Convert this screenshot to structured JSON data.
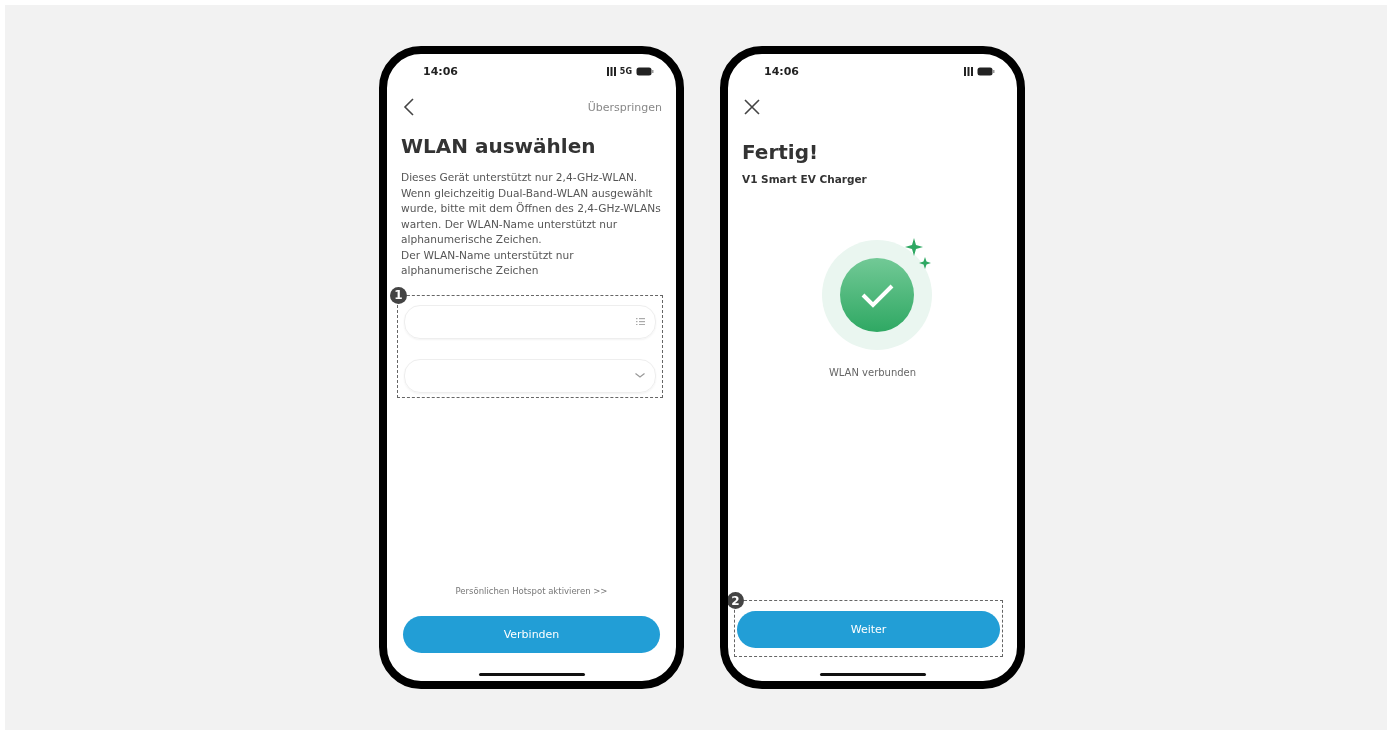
{
  "screens": [
    {
      "kind": "wifi-setup",
      "status_bar": {
        "time": "14:06",
        "network": "5G"
      },
      "skip": "Überspringen",
      "title": "WLAN auswählen",
      "description": [
        "Dieses Gerät unterstützt nur 2,4-GHz-WLAN. Wenn gleichzeitig Dual-Band-WLAN ausgewählt wurde, bitte mit dem Öffnen des 2,4-GHz-WLANs warten. Der WLAN-Name unterstützt nur alphanumerische Zeichen.",
        "Der WLAN-Name unterstützt nur alphanumerische Zeichen"
      ],
      "callout": "1",
      "fields": [
        {
          "kind": "list"
        },
        {
          "kind": "dropdown"
        }
      ],
      "link": "Persönlichen Hotspot aktivieren >>",
      "button": "Verbinden"
    },
    {
      "kind": "success",
      "status_bar": {
        "time": "14:06"
      },
      "title": "Fertig!",
      "subtitle": "V1 Smart EV Charger",
      "message": "WLAN verbunden",
      "callout": "2",
      "button": "Weiter"
    }
  ]
}
